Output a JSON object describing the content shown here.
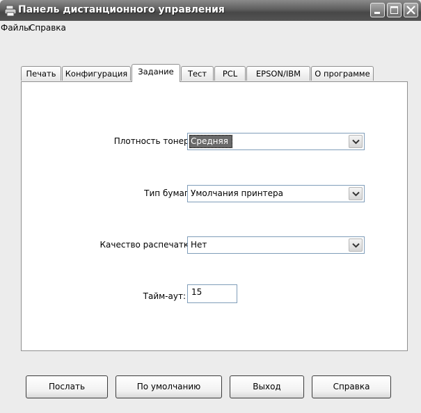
{
  "window": {
    "title": "Панель дистанционного управления",
    "title_bar_color": "#5a5a5a"
  },
  "menu": {
    "items": [
      "Файлы",
      "Справка"
    ]
  },
  "tabs": [
    {
      "label": "Печать",
      "active": false
    },
    {
      "label": "Конфигурация",
      "active": false
    },
    {
      "label": "Задание",
      "active": true
    },
    {
      "label": "Тест",
      "active": false
    },
    {
      "label": "PCL",
      "active": false
    },
    {
      "label": "EPSON/IBM",
      "active": false
    },
    {
      "label": "О программе",
      "active": false
    }
  ],
  "form": {
    "toner_density": {
      "label": "Плотность тонера:",
      "value": "Средняя",
      "icon": "chevron-down-icon"
    },
    "paper_type": {
      "label": "Тип бумаги:",
      "value": "Умолчания принтера",
      "icon": "chevron-down-icon"
    },
    "print_quality": {
      "label": "Качество распечатки:",
      "value": "Нет",
      "icon": "chevron-down-icon"
    },
    "timeout": {
      "label": "Тайм-аут:",
      "value": "15"
    }
  },
  "buttons": {
    "send": "Послать",
    "default": "По умолчанию",
    "exit": "Выход",
    "help": "Справка"
  },
  "colors": {
    "selection": "#6a6a6a",
    "panel_bg": "#ffffff",
    "window_bg": "#ececec"
  }
}
